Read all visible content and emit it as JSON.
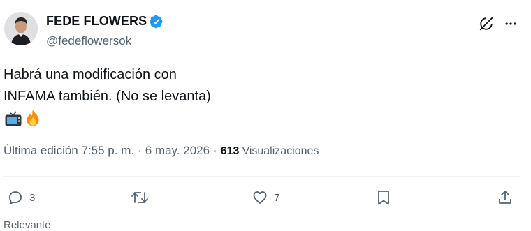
{
  "author": {
    "display_name": "FEDE FLOWERS",
    "handle": "@fedeflowersok",
    "verified": true,
    "avatar_icon": "profile-photo"
  },
  "tweet": {
    "lines": [
      "Habrá una modificación con",
      "INFAMA también. (No se levanta)"
    ],
    "emojis": [
      "television-emoji",
      "fire-emoji"
    ]
  },
  "meta": {
    "edited_time": "Última edición 7:55 p. m.",
    "separator": "·",
    "date": "6 may. 2026",
    "views_count": "613",
    "views_label": "Visualizaciones"
  },
  "actions": {
    "reply_count": "3",
    "retweet_count": "",
    "like_count": "7"
  },
  "below_text": "Relevante",
  "colors": {
    "text": "#0f1419",
    "secondary": "#536471",
    "verified_blue": "#1d9bf0",
    "divider": "#eff3f4"
  }
}
